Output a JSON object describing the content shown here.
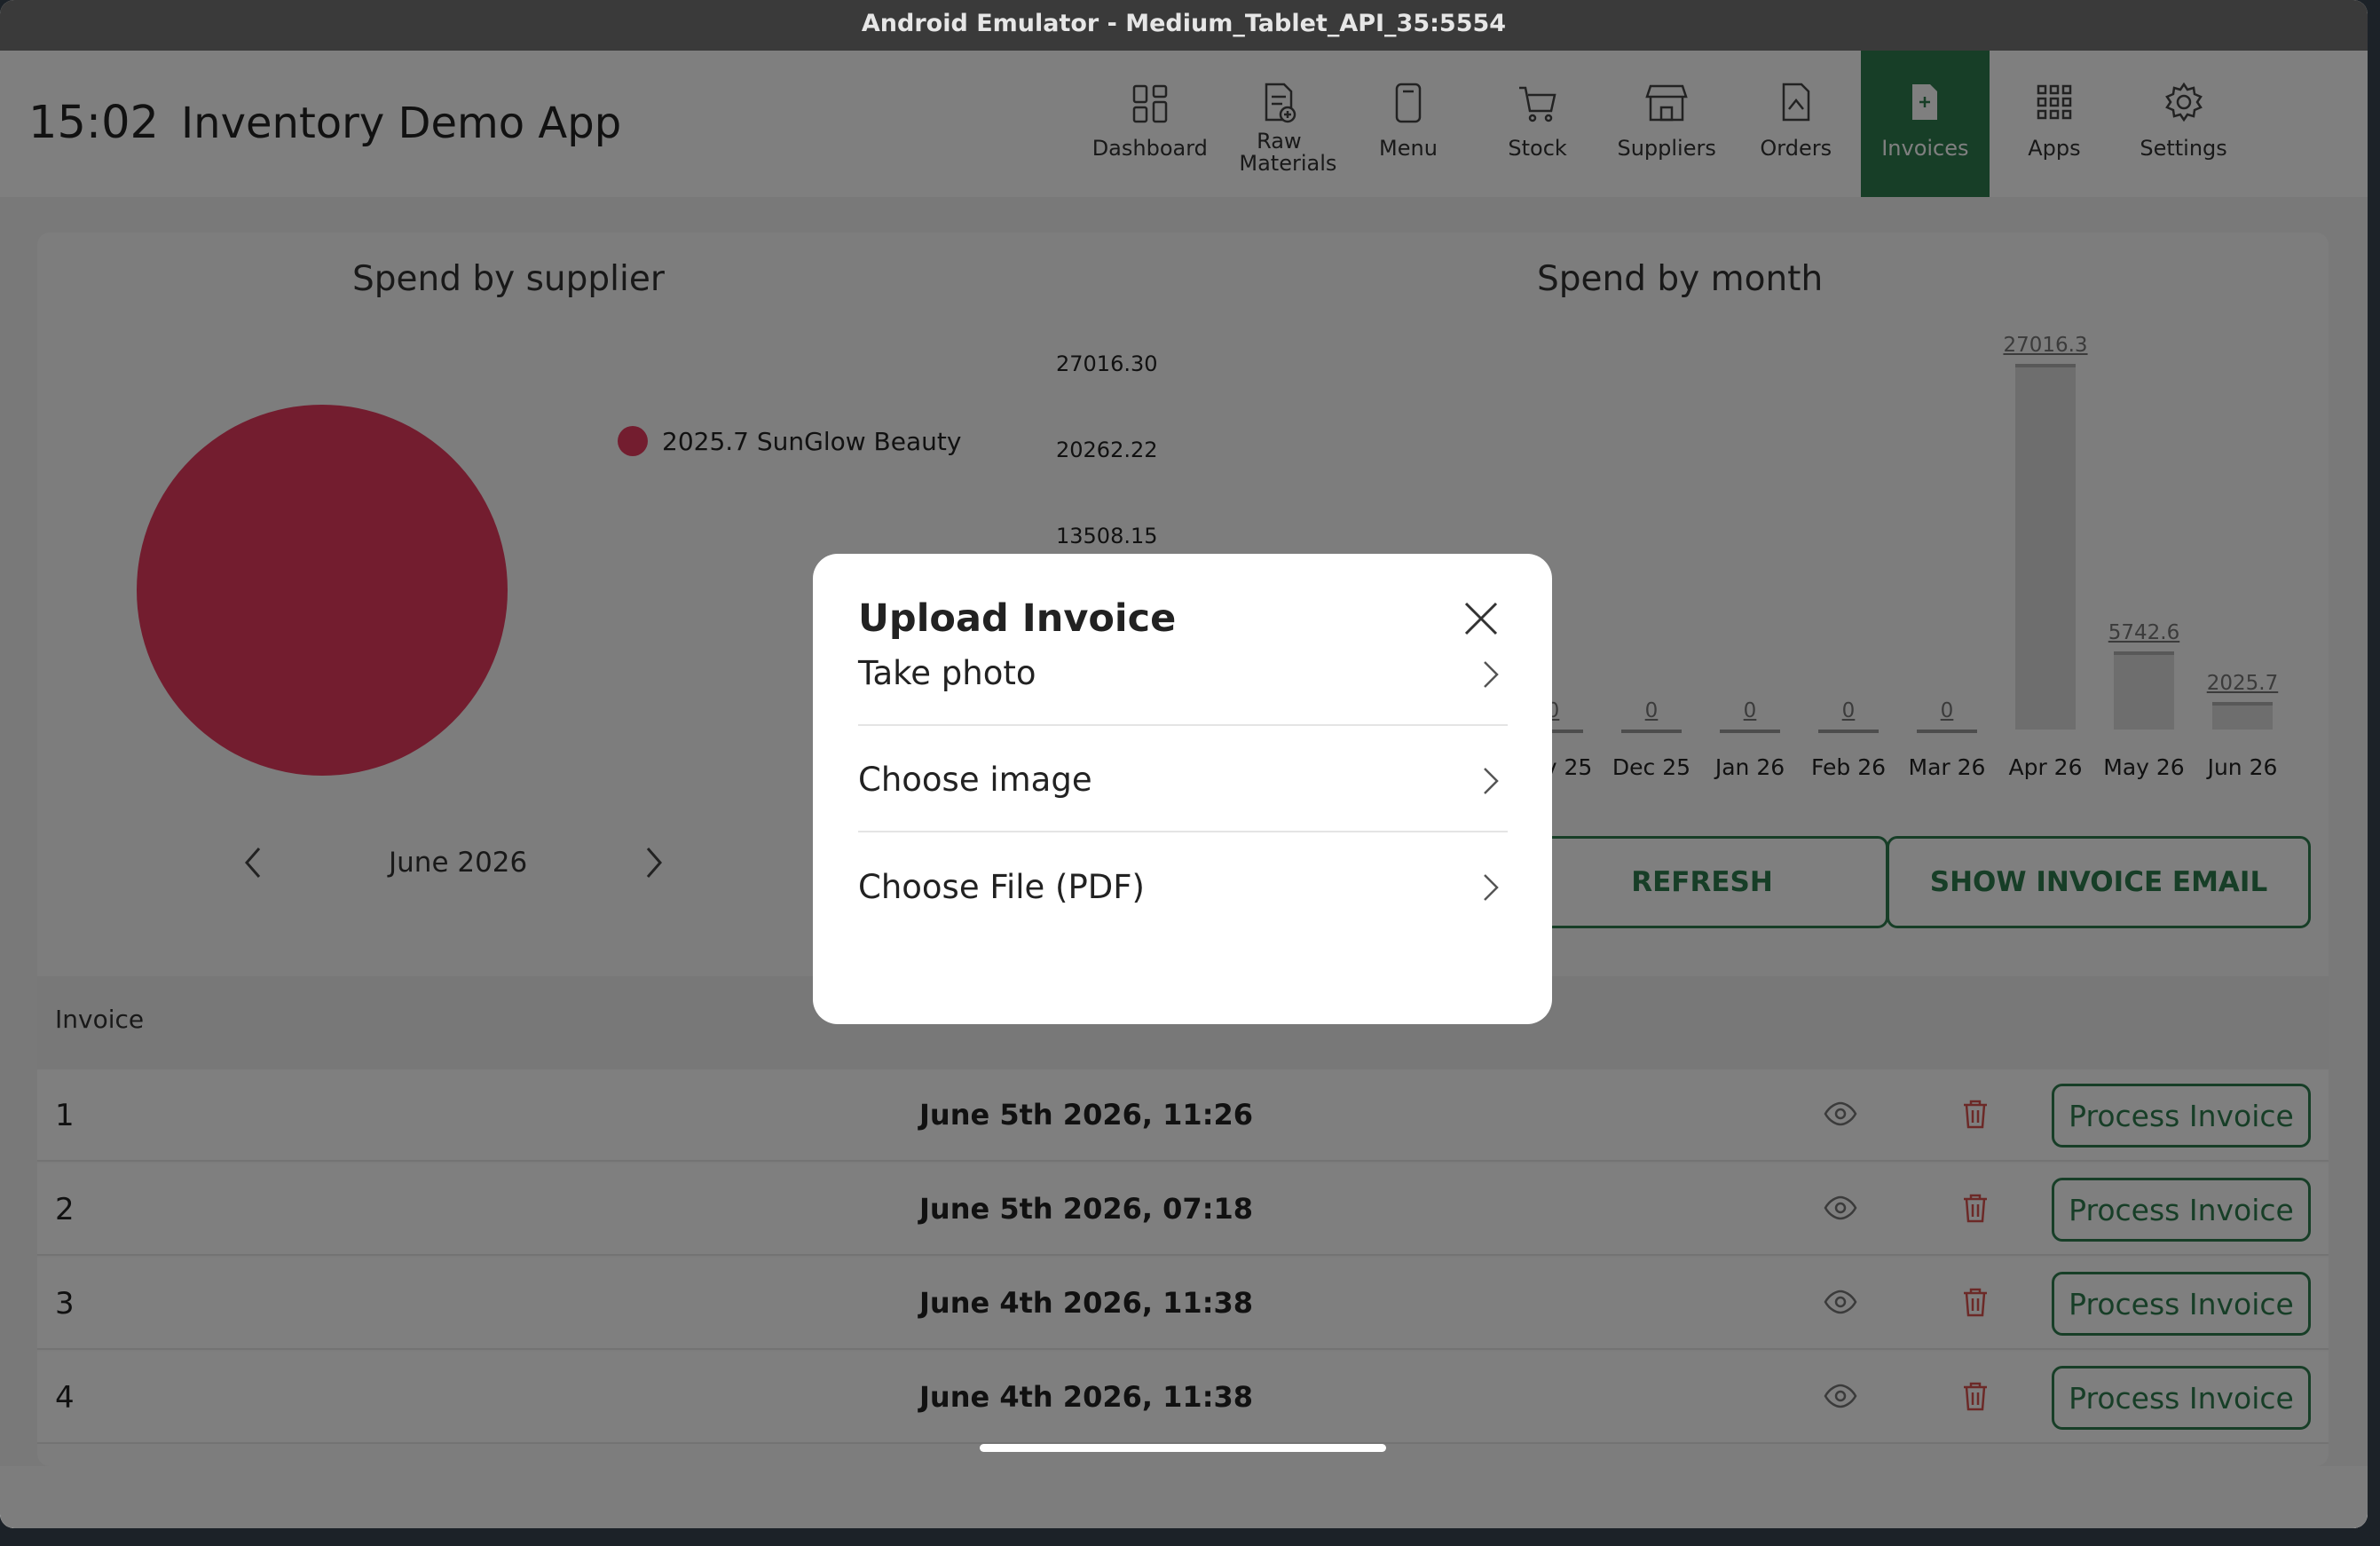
{
  "window": {
    "title": "Android Emulator - Medium_Tablet_API_35:5554"
  },
  "appbar": {
    "time": "15:02",
    "title": "Inventory Demo App"
  },
  "nav": [
    {
      "label": "Dashboard",
      "icon": "dashboard-icon"
    },
    {
      "label": "Raw Materials",
      "icon": "raw-materials-icon"
    },
    {
      "label": "Menu",
      "icon": "menu-icon"
    },
    {
      "label": "Stock",
      "icon": "cart-icon"
    },
    {
      "label": "Suppliers",
      "icon": "store-icon"
    },
    {
      "label": "Orders",
      "icon": "orders-icon"
    },
    {
      "label": "Invoices",
      "icon": "invoice-icon",
      "active": true
    },
    {
      "label": "Apps",
      "icon": "apps-grid-icon"
    },
    {
      "label": "Settings",
      "icon": "gear-icon"
    }
  ],
  "supplier_chart": {
    "title": "Spend by supplier",
    "legend": "2025.7 SunGlow Beauty",
    "month": "June 2026"
  },
  "chart_data": [
    {
      "type": "pie",
      "title": "Spend by supplier",
      "slices": [
        {
          "label": "SunGlow Beauty",
          "value": 2025.7,
          "color": "#e63a5e"
        }
      ]
    },
    {
      "type": "bar",
      "title": "Spend by month",
      "categories": [
        "Nov 25",
        "Dec 25",
        "Jan 26",
        "Feb 26",
        "Mar 26",
        "Apr 26",
        "May 26",
        "Jun 26"
      ],
      "values": [
        0,
        0,
        0,
        0,
        0,
        27016.3,
        5742.6,
        2025.7
      ],
      "value_labels": [
        "0",
        "0",
        "0",
        "0",
        "0",
        "27016.3",
        "5742.6",
        "2025.7"
      ],
      "y_ticks": [
        "27016.30",
        "20262.22",
        "13508.15"
      ],
      "ylim": [
        0,
        27016.3
      ]
    }
  ],
  "month_chart": {
    "title": "Spend by month"
  },
  "actions": {
    "refresh": "REFRESH",
    "show_email": "SHOW INVOICE EMAIL"
  },
  "table": {
    "header": "Invoice",
    "action_label": "Process Invoice",
    "rows": [
      {
        "num": "1",
        "date": "June 5th 2026, 11:26"
      },
      {
        "num": "2",
        "date": "June 5th 2026, 07:18"
      },
      {
        "num": "3",
        "date": "June 4th 2026, 11:38"
      },
      {
        "num": "4",
        "date": "June 4th 2026, 11:38"
      }
    ]
  },
  "modal": {
    "title": "Upload Invoice",
    "items": [
      "Take photo",
      "Choose image",
      "Choose File (PDF)"
    ]
  },
  "colors": {
    "accent": "#2e7d4f",
    "pie": "#e63a5e",
    "trash": "#d9534f"
  }
}
